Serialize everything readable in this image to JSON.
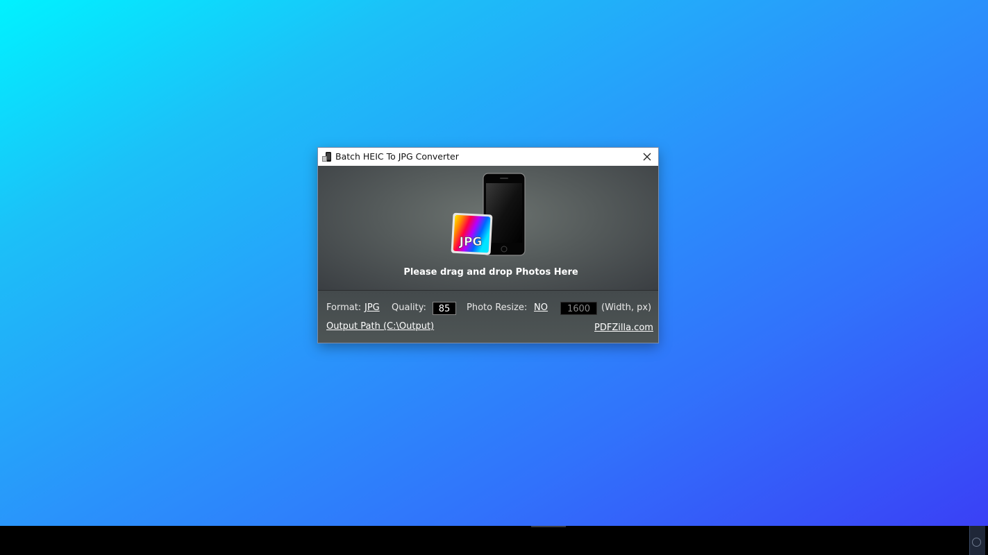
{
  "window": {
    "title": "Batch HEIC To JPG Converter"
  },
  "dropzone": {
    "badge_text": "JPG",
    "drop_text": "Please drag and drop Photos Here"
  },
  "options": {
    "format_label": "Format:",
    "format_value": "JPG",
    "quality_label": "Quality:",
    "quality_value": "85",
    "resize_label": "Photo Resize:",
    "resize_value": "NO",
    "width_value": "1600",
    "width_unit": "(Width, px)",
    "output_path": "Output Path (C:\\Output)",
    "website": "PDFZilla.com"
  },
  "colors": {
    "desktop_top_left": "#00f2ff",
    "desktop_bottom_right": "#3a40f6",
    "taskbar": "#000000"
  }
}
